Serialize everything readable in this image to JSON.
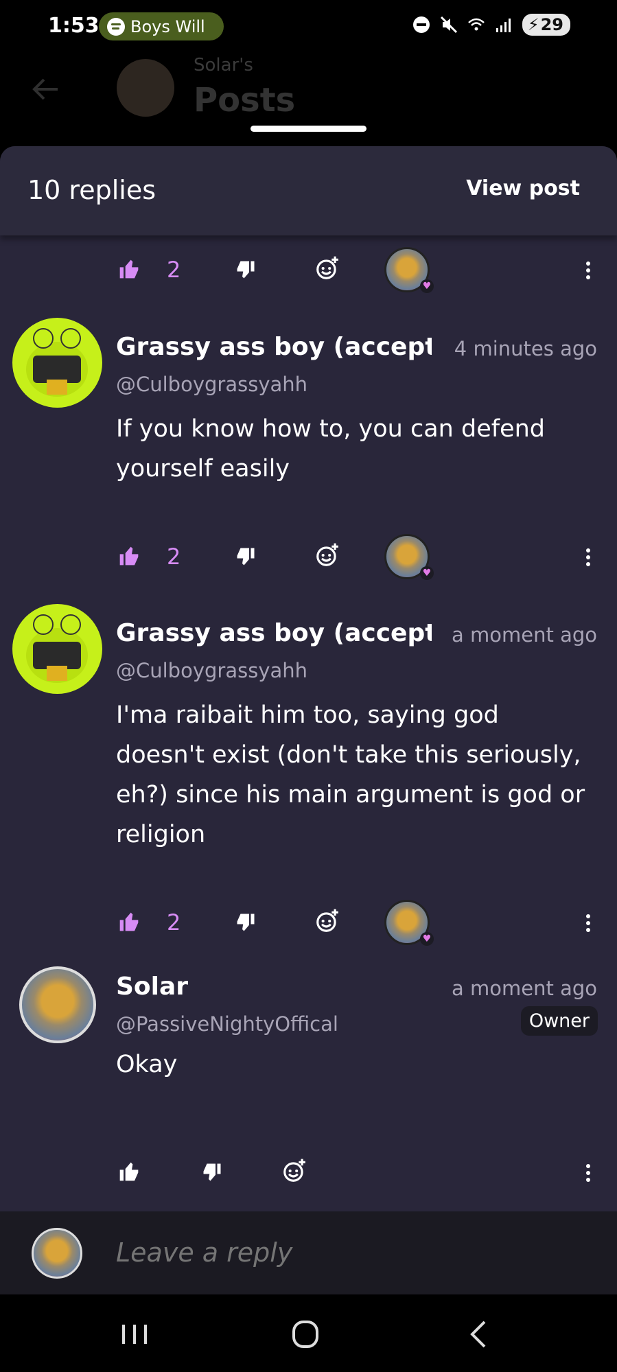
{
  "status_bar": {
    "time": "1:53",
    "media_label": "Boys Will",
    "battery": "29"
  },
  "background": {
    "subtitle": "Solar's",
    "title": "Posts"
  },
  "sheet": {
    "replies_count": "10 replies",
    "view_post": "View post"
  },
  "top_actions": {
    "likes": "2"
  },
  "comments": [
    {
      "name": "Grassy ass boy (accept t",
      "time": "4 minutes ago",
      "handle": "@Culboygrassyahh",
      "body": "If you know how to, you can defend yourself easily",
      "likes": "2"
    },
    {
      "name": "Grassy ass boy (accept t",
      "time": "a moment ago",
      "handle": "@Culboygrassyahh",
      "body": "I'ma raibait him too, saying god doesn't exist (don't take this seriously, eh?) since his main argument is god or religion",
      "likes": "2"
    },
    {
      "name": "Solar",
      "time": "a moment ago",
      "handle": "@PassiveNightyOffical",
      "badge": "Owner",
      "body": "Okay"
    }
  ],
  "reply_bar": {
    "placeholder": "Leave a reply"
  },
  "colors": {
    "sheet_bg": "#29263a",
    "like_accent": "#d78cf5",
    "secondary_text": "#a8a4b6"
  },
  "icons": [
    "thumbs-up-icon",
    "thumbs-down-icon",
    "add-reaction-icon",
    "more-vertical-icon",
    "back-arrow-icon",
    "recents-icon",
    "home-icon",
    "nav-back-icon"
  ]
}
